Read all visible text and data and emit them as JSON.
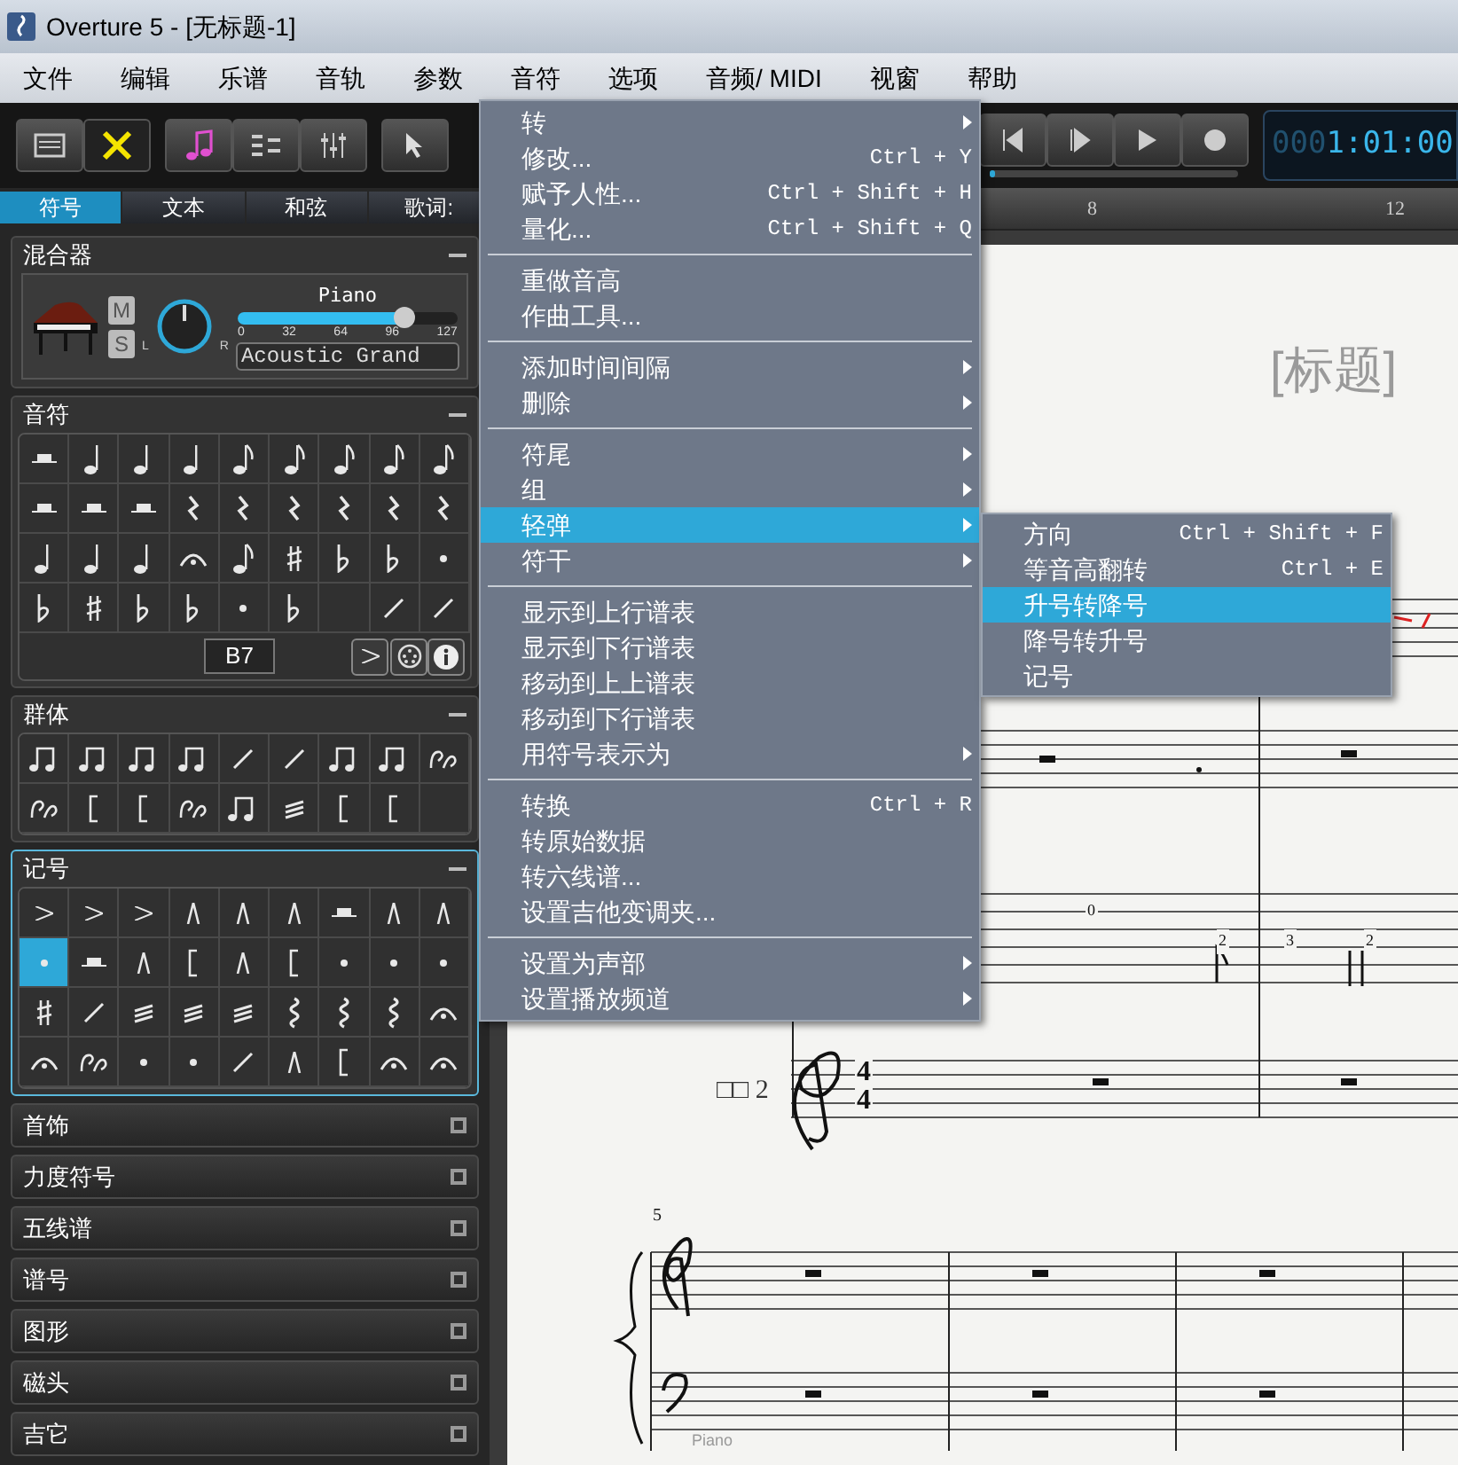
{
  "window": {
    "title": "Overture 5 - [无标题-1]"
  },
  "menu_bar": [
    "文件",
    "编辑",
    "乐谱",
    "音轨",
    "参数",
    "音符",
    "选项",
    "音频/ MIDI",
    "视窗",
    "帮助"
  ],
  "transport": {
    "position": {
      "level": 0.02
    },
    "counter_dim": "000",
    "counter": "1:01:00"
  },
  "palette_tabs": [
    {
      "label": "符号",
      "selected": true
    },
    {
      "label": "文本",
      "selected": false
    },
    {
      "label": "和弦",
      "selected": false
    },
    {
      "label": "歌词:",
      "selected": false
    }
  ],
  "mixer": {
    "title": "混合器",
    "expanded": true,
    "mute": "M",
    "solo": "S",
    "pan_left": "L",
    "pan_right": "R",
    "track": "Piano",
    "volume": {
      "level": 0.76
    },
    "ticks": [
      "0",
      "32",
      "64",
      "96",
      "127"
    ],
    "instrument": "Acoustic Grand"
  },
  "notes_panel": {
    "title": "音符",
    "expanded": true,
    "chord_field": "B7"
  },
  "groups_panel": {
    "title": "群体",
    "expanded": true
  },
  "marks_panel": {
    "title": "记号",
    "expanded": true,
    "cells": [
      {
        "selected": false
      },
      {
        "selected": false
      },
      {
        "selected": false
      },
      {
        "selected": false
      },
      {
        "selected": false
      },
      {
        "selected": false
      },
      {
        "selected": false
      },
      {
        "selected": false
      },
      {
        "selected": false
      },
      {
        "selected": true
      },
      {
        "selected": false
      },
      {
        "selected": false
      },
      {
        "selected": false
      },
      {
        "selected": false
      },
      {
        "selected": false
      },
      {
        "selected": false
      },
      {
        "selected": false
      },
      {
        "selected": false
      },
      {
        "selected": false
      },
      {
        "selected": false
      },
      {
        "selected": false
      },
      {
        "selected": false
      },
      {
        "selected": false
      },
      {
        "selected": false
      },
      {
        "selected": false
      },
      {
        "selected": false
      },
      {
        "selected": false
      },
      {
        "selected": false
      },
      {
        "selected": false
      },
      {
        "selected": false
      },
      {
        "selected": false
      },
      {
        "selected": false
      },
      {
        "selected": false
      },
      {
        "selected": false
      },
      {
        "selected": false
      },
      {
        "selected": false
      }
    ]
  },
  "collapsed_panels": [
    {
      "title": "首饰",
      "expanded": false
    },
    {
      "title": "力度符号",
      "expanded": false
    },
    {
      "title": "五线谱",
      "expanded": false
    },
    {
      "title": "谱号",
      "expanded": false
    },
    {
      "title": "图形",
      "expanded": false
    },
    {
      "title": "磁头",
      "expanded": false
    },
    {
      "title": "吉它",
      "expanded": false
    }
  ],
  "ruler": [
    "8",
    "12"
  ],
  "score": {
    "title": "[标题]",
    "staff2_label": "□□ 2",
    "staff2_time": [
      "4",
      "4"
    ],
    "tab_numbers": [
      "0",
      "2",
      "3",
      "2"
    ],
    "system2_number": "5",
    "bottom_label": "Piano"
  },
  "context_menu": {
    "sections": [
      [
        {
          "label": "转",
          "submenu": true,
          "selected": false
        },
        {
          "label": "修改...",
          "shortcut": "Ctrl + Y",
          "submenu": false,
          "selected": false
        },
        {
          "label": "赋予人性...",
          "shortcut": "Ctrl + Shift + H",
          "submenu": false,
          "selected": false
        },
        {
          "label": "量化...",
          "shortcut": "Ctrl + Shift + Q",
          "submenu": false,
          "selected": false
        }
      ],
      [
        {
          "label": "重做音高",
          "submenu": false,
          "selected": false
        },
        {
          "label": "作曲工具...",
          "submenu": false,
          "selected": false
        }
      ],
      [
        {
          "label": "添加时间间隔",
          "submenu": true,
          "selected": false
        },
        {
          "label": "删除",
          "submenu": true,
          "selected": false
        }
      ],
      [
        {
          "label": "符尾",
          "submenu": true,
          "selected": false
        },
        {
          "label": "组",
          "submenu": true,
          "selected": false
        },
        {
          "label": "轻弹",
          "submenu": true,
          "selected": true
        },
        {
          "label": "符干",
          "submenu": true,
          "selected": false
        }
      ],
      [
        {
          "label": "显示到上行谱表",
          "submenu": false,
          "selected": false
        },
        {
          "label": "显示到下行谱表",
          "submenu": false,
          "selected": false
        },
        {
          "label": "移动到上上谱表",
          "submenu": false,
          "selected": false
        },
        {
          "label": "移动到下行谱表",
          "submenu": false,
          "selected": false
        },
        {
          "label": "用符号表示为",
          "submenu": true,
          "selected": false
        }
      ],
      [
        {
          "label": "转换",
          "shortcut": "Ctrl + R",
          "submenu": false,
          "selected": false
        },
        {
          "label": "转原始数据",
          "submenu": false,
          "selected": false
        },
        {
          "label": "转六线谱...",
          "submenu": false,
          "selected": false
        },
        {
          "label": "设置吉他变调夹...",
          "submenu": false,
          "selected": false
        }
      ],
      [
        {
          "label": "设置为声部",
          "submenu": true,
          "selected": false
        },
        {
          "label": "设置播放频道",
          "submenu": true,
          "selected": false
        }
      ]
    ],
    "submenu": [
      {
        "label": "方向",
        "shortcut": "Ctrl + Shift + F",
        "selected": false
      },
      {
        "label": "等音高翻转",
        "shortcut": "Ctrl + E",
        "selected": false
      },
      {
        "label": "升号转降号",
        "selected": true
      },
      {
        "label": "降号转升号",
        "selected": false
      },
      {
        "label": "记号",
        "selected": false
      }
    ]
  }
}
